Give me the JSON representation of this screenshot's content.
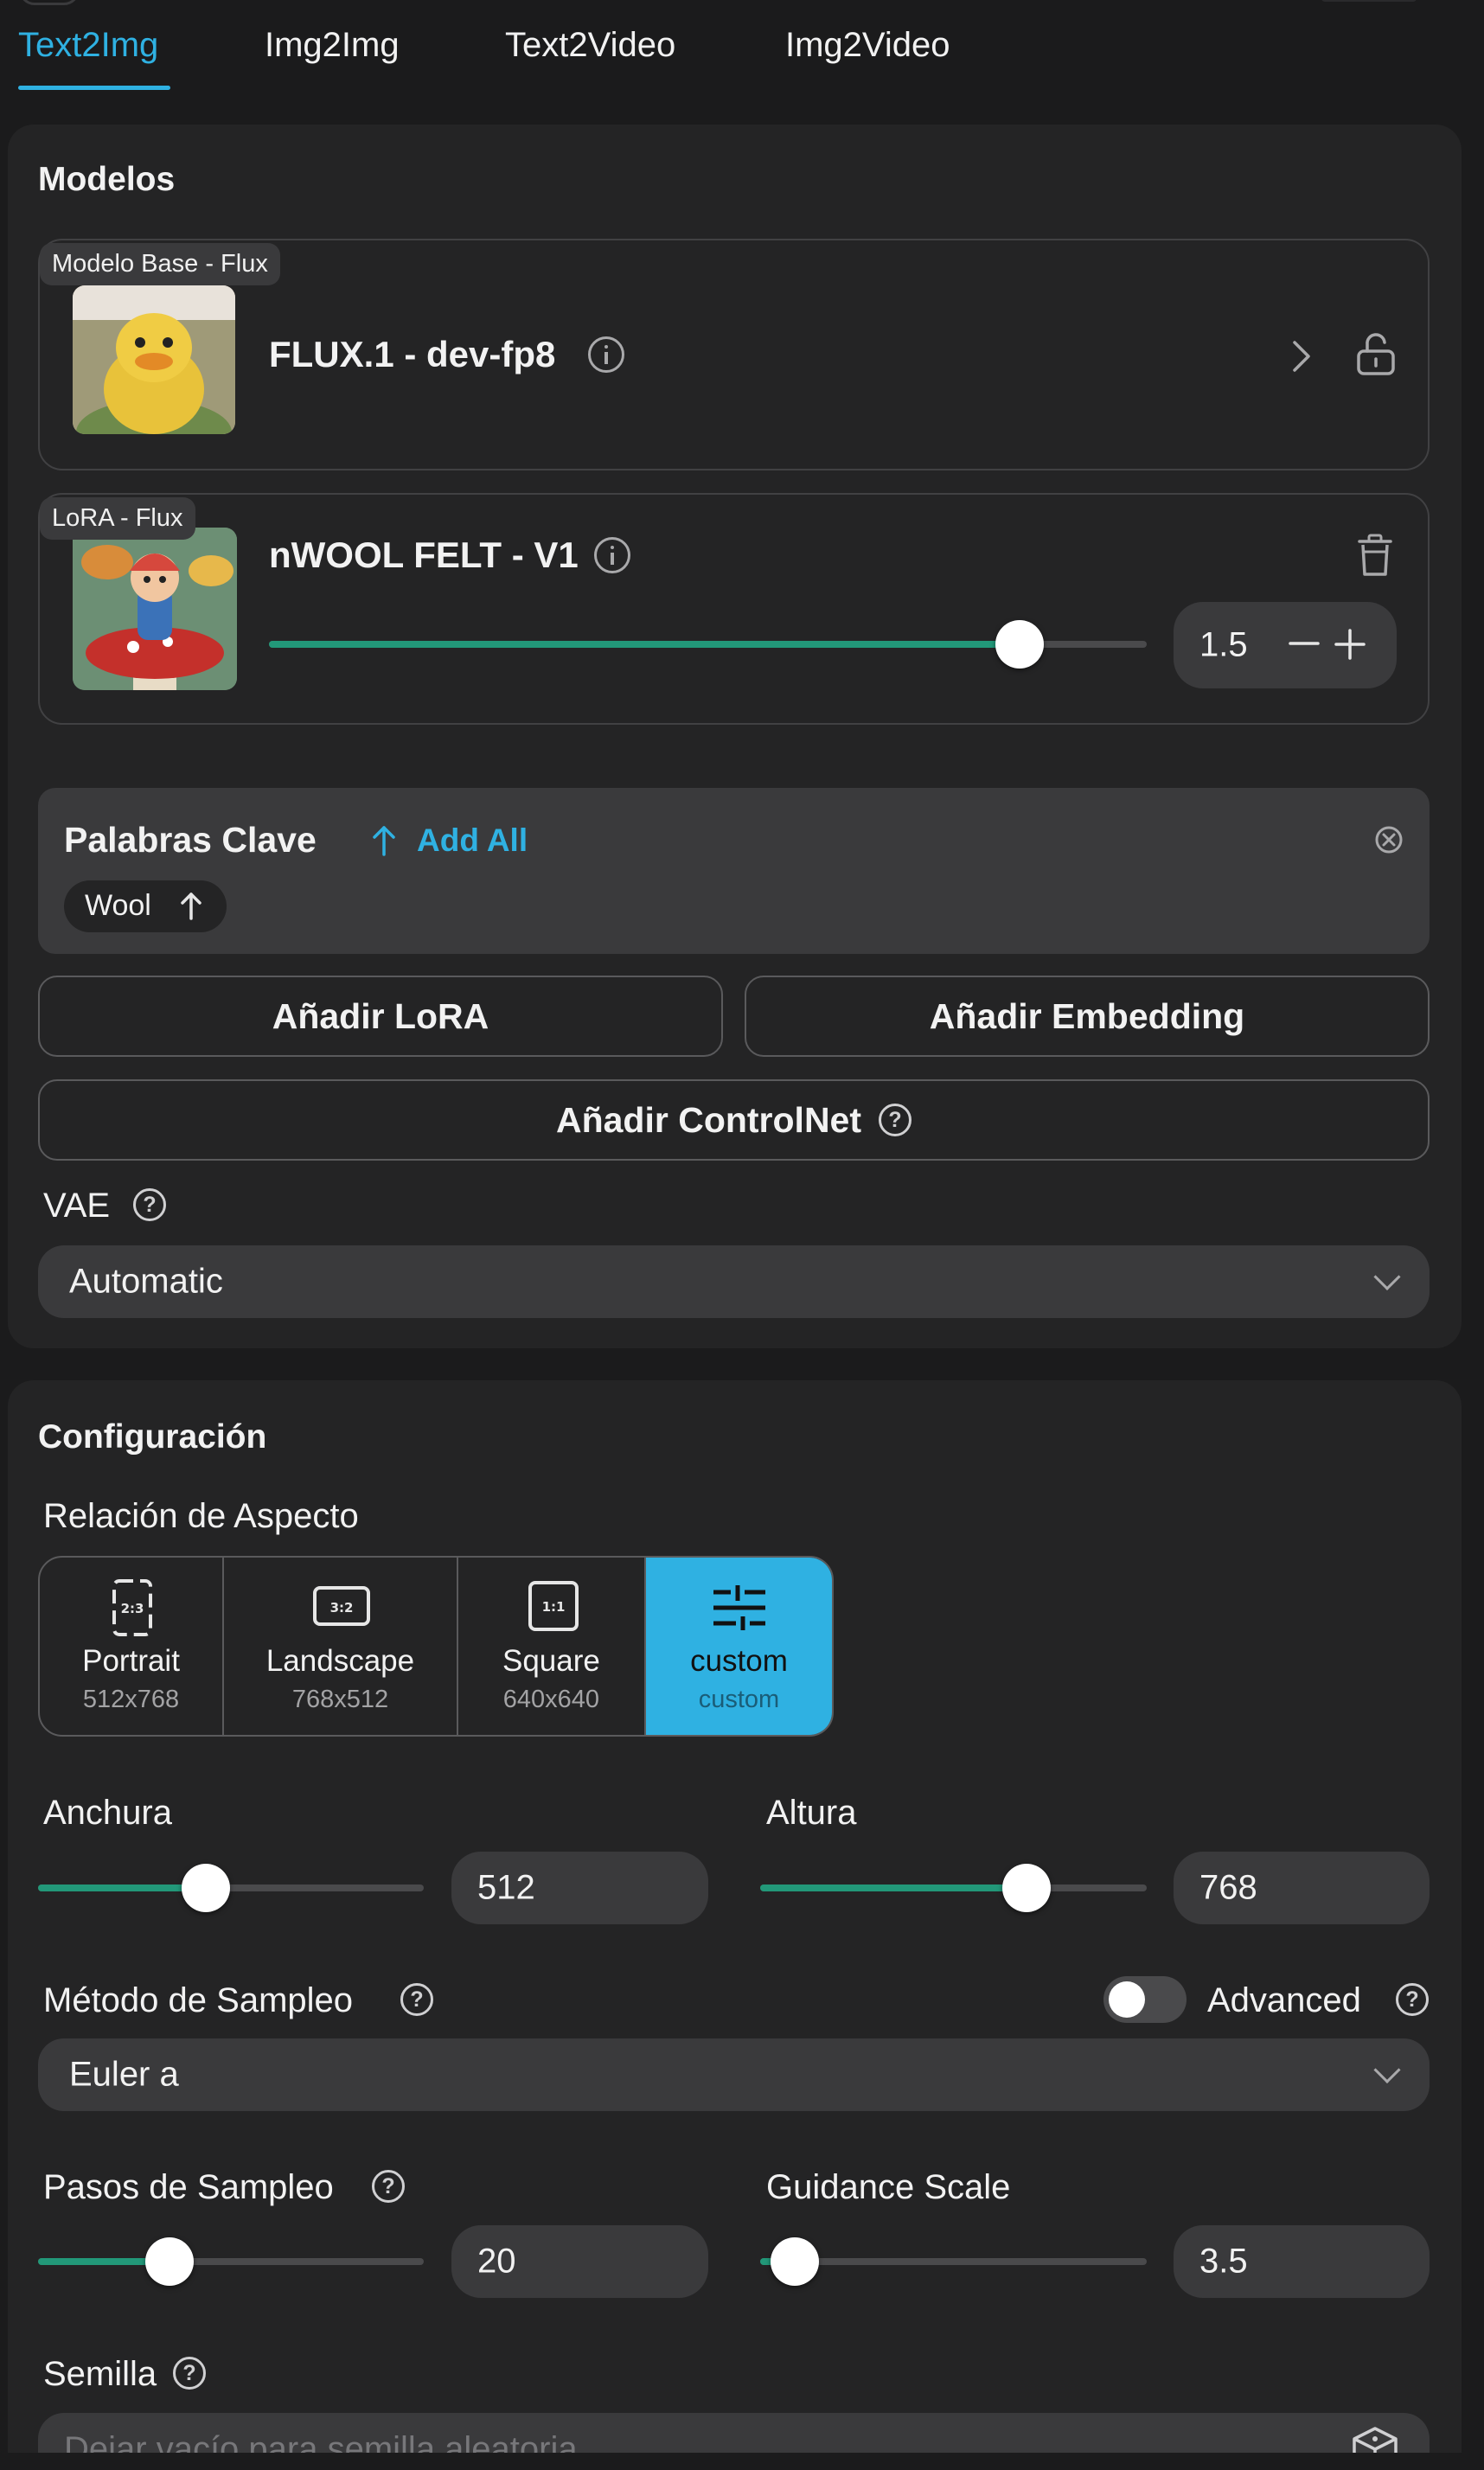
{
  "tabs": [
    {
      "label": "Text2Img",
      "active": true
    },
    {
      "label": "Img2Img",
      "active": false
    },
    {
      "label": "Text2Video",
      "active": false
    },
    {
      "label": "Img2Video",
      "active": false
    }
  ],
  "models": {
    "title": "Modelos",
    "base": {
      "tag": "Modelo Base - Flux",
      "name": "FLUX.1 - dev-fp8"
    },
    "lora": {
      "tag": "LoRA - Flux",
      "name": "nWOOL FELT - V1",
      "weight": "1.5",
      "weight_fraction": 0.855
    },
    "keywords": {
      "title": "Palabras Clave",
      "add_all": "Add All",
      "chips": [
        "Wool"
      ]
    },
    "add_lora": "Añadir LoRA",
    "add_embedding": "Añadir Embedding",
    "add_controlnet": "Añadir ControlNet",
    "vae_label": "VAE",
    "vae_value": "Automatic"
  },
  "config": {
    "title": "Configuración",
    "aspect_label": "Relación de Aspecto",
    "aspects": [
      {
        "name": "Portrait",
        "dims": "512x768",
        "icon": "2:3",
        "active": false
      },
      {
        "name": "Landscape",
        "dims": "768x512",
        "icon": "3:2",
        "active": false
      },
      {
        "name": "Square",
        "dims": "640x640",
        "icon": "1:1",
        "active": false
      },
      {
        "name": "custom",
        "dims": "custom",
        "icon": "sliders-icon",
        "active": true
      }
    ],
    "width_label": "Anchura",
    "width_value": "512",
    "width_fraction": 0.435,
    "height_label": "Altura",
    "height_value": "768",
    "height_fraction": 0.69,
    "sampler_label": "Método de Sampleo",
    "advanced_label": "Advanced",
    "advanced_on": false,
    "sampler_value": "Euler a",
    "steps_label": "Pasos de Sampleo",
    "steps_value": "20",
    "steps_fraction": 0.34,
    "guidance_label": "Guidance Scale",
    "guidance_value": "3.5",
    "guidance_fraction": 0.09,
    "seed_label": "Semilla",
    "seed_placeholder": "Dejar vacío para semilla aleatoria"
  },
  "colors": {
    "accent": "#2fb1e2",
    "slider": "#229879",
    "panel": "#242425",
    "background": "#1b1b1c"
  }
}
